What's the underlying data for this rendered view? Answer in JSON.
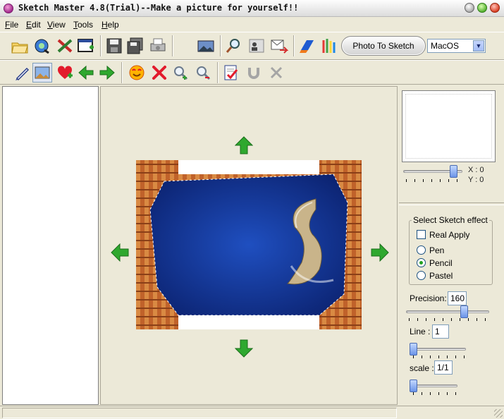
{
  "window": {
    "title": "Sketch Master 4.8(Trial)--Make a picture for yourself!!",
    "icons": {
      "app": "app-icon",
      "minimize": "minimize-button",
      "maximize": "maximize-button",
      "close": "close-button"
    }
  },
  "menu": {
    "items": [
      {
        "label": "File",
        "accel": "F"
      },
      {
        "label": "Edit",
        "accel": "E"
      },
      {
        "label": "View",
        "accel": "V"
      },
      {
        "label": "Tools",
        "accel": "T"
      },
      {
        "label": "Help",
        "accel": "H"
      }
    ]
  },
  "toolbar1": {
    "icons": [
      "open-folder-icon",
      "scan-icon",
      "tools-icon",
      "new-canvas-icon",
      "save-icon",
      "save-all-icon",
      "print-icon",
      "landscape-icon",
      "zoom-icon",
      "contact-icon",
      "email-icon",
      "effect-icon",
      "brush-icon"
    ],
    "photo_to_sketch_label": "Photo To Sketch",
    "style_select": {
      "value": "MacOS"
    }
  },
  "toolbar2": {
    "icons": [
      "pen-icon",
      "image-icon",
      "heart-add-icon",
      "arrow-left-icon",
      "arrow-right-icon",
      "smiley-icon",
      "delete-icon",
      "zoom-in-icon",
      "zoom-out-icon",
      "check-document-icon",
      "undo-icon",
      "cancel-icon"
    ]
  },
  "preview": {
    "x_label": "X : 0",
    "y_label": "Y : 0",
    "slider_fraction": 0.9
  },
  "effect": {
    "group_label": "Select Sketch effect",
    "real_apply_label": "Real Apply",
    "real_apply_checked": false,
    "options": [
      {
        "label": "Pen",
        "selected": false
      },
      {
        "label": "Pencil",
        "selected": true
      },
      {
        "label": "Pastel",
        "selected": false
      }
    ]
  },
  "settings": {
    "precision_label": "Precision:",
    "precision_value": "160",
    "precision_fraction": 0.72,
    "line_label": "Line :",
    "line_value": "1",
    "line_fraction": 0.0,
    "scale_label": "scale :",
    "scale_value": "1/1",
    "scale_fraction": 0.0
  },
  "colors": {
    "frame": "#ece9d8",
    "accent_green": "#2fa82f",
    "photo_blue": "#0d2a8a",
    "photo_orange": "#c0622a"
  }
}
